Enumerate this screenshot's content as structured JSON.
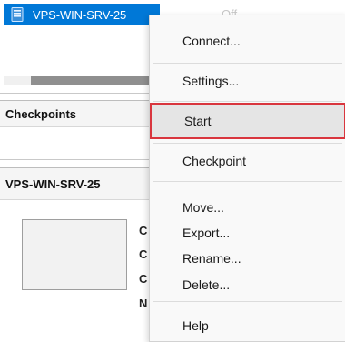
{
  "vm_list": {
    "selected_vm": {
      "name": "VPS-WIN-SRV-25",
      "state": "Off"
    }
  },
  "sections": {
    "checkpoints_title": "Checkpoints",
    "vm_detail_title": "VPS-WIN-SRV-25",
    "detail_letters": [
      "C",
      "C",
      "C",
      "N"
    ]
  },
  "context_menu": {
    "items": [
      {
        "label": "Connect..."
      },
      {
        "label": "Settings..."
      },
      {
        "label": "Start",
        "highlighted": true
      },
      {
        "label": "Checkpoint"
      },
      {
        "label": "Move..."
      },
      {
        "label": "Export..."
      },
      {
        "label": "Rename..."
      },
      {
        "label": "Delete..."
      },
      {
        "label": "Help"
      }
    ]
  },
  "colors": {
    "selection": "#0078d7",
    "highlight_border": "#d9363e"
  }
}
